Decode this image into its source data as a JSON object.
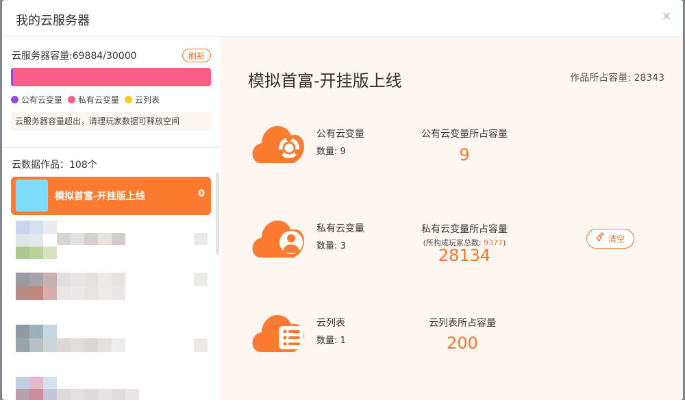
{
  "modal": {
    "title": "我的云服务器",
    "close_glyph": "×"
  },
  "capacity": {
    "label": "云服务器容量:69884/30000",
    "refresh_label": "刷新",
    "public_fraction": 0.0001,
    "warning": "云服务器容量超出，清理玩家数据可释放空间",
    "legend": [
      {
        "label": "公有云变量",
        "color": "#9b45e6"
      },
      {
        "label": "私有云变量",
        "color": "#fb5d84"
      },
      {
        "label": "云列表",
        "color": "#fdcb1f"
      }
    ]
  },
  "works": {
    "count_label": "云数据作品：108个",
    "selected": {
      "title": "模拟首富-开挂版上线",
      "value": "0"
    }
  },
  "detail": {
    "work_title": "模拟首富-开挂版上线",
    "total_capacity": "作品所占容量: 28343",
    "rows": [
      {
        "name": "公有云变量",
        "count": "数量: 9",
        "cap_label": "公有云变量所占容量",
        "cap_value": "9",
        "icon": "cloud-public-variable-icon"
      },
      {
        "name": "私有云变量",
        "count": "数量: 3",
        "cap_label": "私有云变量所占容量",
        "cap_sub_prefix": "(所构成玩家总数: ",
        "cap_sub_value": "9377",
        "cap_sub_suffix": ")",
        "cap_value": "28134",
        "icon": "cloud-private-variable-icon"
      },
      {
        "name": "云列表",
        "count": "数量: 1",
        "cap_label": "云列表所占容量",
        "cap_value": "200",
        "icon": "cloud-list-icon"
      }
    ],
    "clear_label": "清空"
  },
  "colors": {
    "accent": "#f0762e",
    "work_selected": "#fc7b30",
    "capacity_bar": "#fb5d84",
    "public_bar": "#8e4de0"
  }
}
